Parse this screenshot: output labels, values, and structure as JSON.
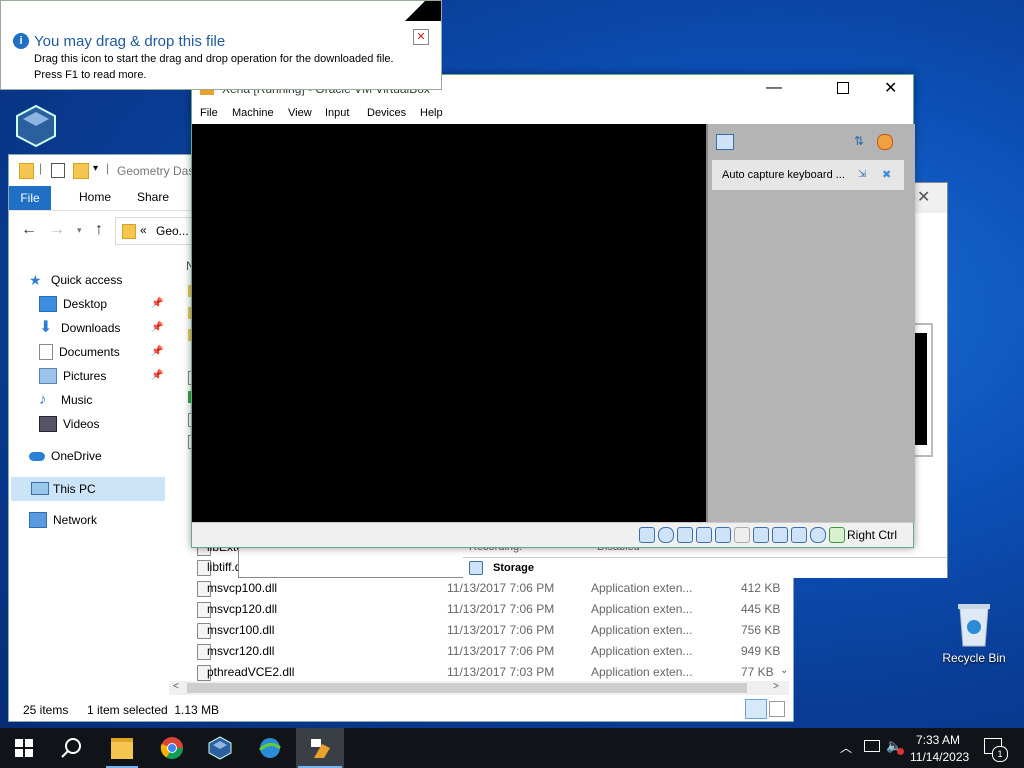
{
  "notification": {
    "title": "You may drag & drop this file",
    "body_line1": "Drag this icon to start the drag and drop operation for the downloaded file.",
    "body_line2": "Press F1 to read more."
  },
  "vbox": {
    "title": "Xena [Running] - Oracle VM VirtualBox",
    "menu": [
      "File",
      "Machine",
      "View",
      "Input",
      "Devices",
      "Help"
    ],
    "notice_text": "Auto capture keyboard ...",
    "host_key": "Right Ctrl"
  },
  "settings_window": {
    "recording_label": "Recording:",
    "recording_value": "Disabled",
    "storage_label": "Storage"
  },
  "explorer": {
    "title": "Geometry Das",
    "ribbon_tabs": [
      "File",
      "Home",
      "Share"
    ],
    "address": "Geo...",
    "address_prefix": "«",
    "nav": {
      "quick_access": "Quick access",
      "desktop": "Desktop",
      "downloads": "Downloads",
      "documents": "Documents",
      "pictures": "Pictures",
      "music": "Music",
      "videos": "Videos",
      "onedrive": "OneDrive",
      "this_pc": "This PC",
      "network": "Network"
    },
    "column_header": "N",
    "files_partial": [
      "libExte",
      "libtiff.d"
    ],
    "files": [
      {
        "name": "msvcp100.dll",
        "date": "11/13/2017 7:06 PM",
        "type": "Application exten...",
        "size": "412 KB"
      },
      {
        "name": "msvcp120.dll",
        "date": "11/13/2017 7:06 PM",
        "type": "Application exten...",
        "size": "445 KB"
      },
      {
        "name": "msvcr100.dll",
        "date": "11/13/2017 7:06 PM",
        "type": "Application exten...",
        "size": "756 KB"
      },
      {
        "name": "msvcr120.dll",
        "date": "11/13/2017 7:06 PM",
        "type": "Application exten...",
        "size": "949 KB"
      },
      {
        "name": "pthreadVCE2.dll",
        "date": "11/13/2017 7:03 PM",
        "type": "Application exten...",
        "size": "77 KB"
      }
    ],
    "status": {
      "count": "25 items",
      "selected": "1 item selected  1.13 MB"
    }
  },
  "desktop": {
    "recycle_bin": "Recycle Bin"
  },
  "taskbar": {
    "time": "7:33 AM",
    "date": "11/14/2023",
    "notification_count": "1"
  },
  "colors": {
    "accent": "#1f6fc5",
    "file_tab": "#1f6fc5"
  }
}
